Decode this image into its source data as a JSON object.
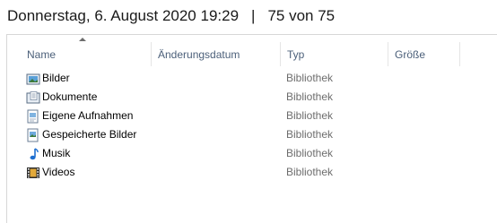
{
  "header": {
    "datetime": "Donnerstag, 6. August 2020 19:29",
    "separator": "|",
    "count": "75 von 75"
  },
  "columns": {
    "name": "Name",
    "date": "Änderungsdatum",
    "type": "Typ",
    "size": "Größe"
  },
  "items": [
    {
      "name": "Bilder",
      "type": "Bibliothek",
      "icon": "pictures-library-icon"
    },
    {
      "name": "Dokumente",
      "type": "Bibliothek",
      "icon": "documents-library-icon"
    },
    {
      "name": "Eigene Aufnahmen",
      "type": "Bibliothek",
      "icon": "camera-roll-library-icon"
    },
    {
      "name": "Gespeicherte Bilder",
      "type": "Bibliothek",
      "icon": "saved-pictures-library-icon"
    },
    {
      "name": "Musik",
      "type": "Bibliothek",
      "icon": "music-library-icon"
    },
    {
      "name": "Videos",
      "type": "Bibliothek",
      "icon": "videos-library-icon"
    }
  ]
}
